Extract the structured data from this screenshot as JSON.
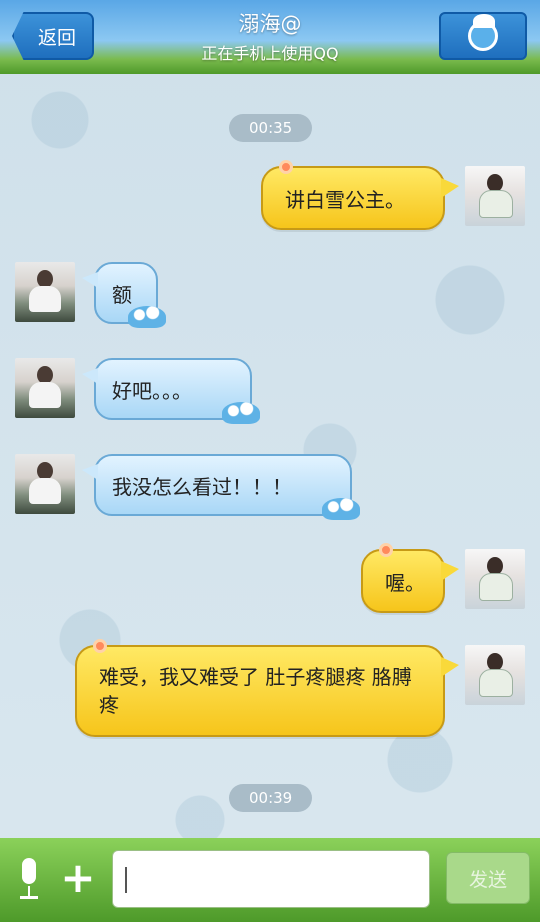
{
  "header": {
    "back_label": "返回",
    "title": "溺海@",
    "subtitle": "正在手机上使用QQ",
    "profile_icon": "smurf-avatar-icon"
  },
  "timestamps": [
    "00:35",
    "00:39"
  ],
  "messages": [
    {
      "side": "right",
      "text": "讲白雪公主。"
    },
    {
      "side": "left",
      "text": "额"
    },
    {
      "side": "left",
      "text": "好吧。。。"
    },
    {
      "side": "left",
      "text": "我没怎么看过！！！"
    },
    {
      "side": "right",
      "text": "喔。"
    },
    {
      "side": "right",
      "text": "难受，我又难受了 肚子疼腿疼 胳膊疼"
    }
  ],
  "input_bar": {
    "mic_icon": "microphone-icon",
    "plus_icon": "plus-icon",
    "input_value": "",
    "send_label": "发送"
  },
  "colors": {
    "header_blue": "#5aa7e6",
    "bubble_yellow": "#f6c51b",
    "bubble_blue": "#a9d7f6",
    "bottom_green": "#4e9a2a"
  }
}
